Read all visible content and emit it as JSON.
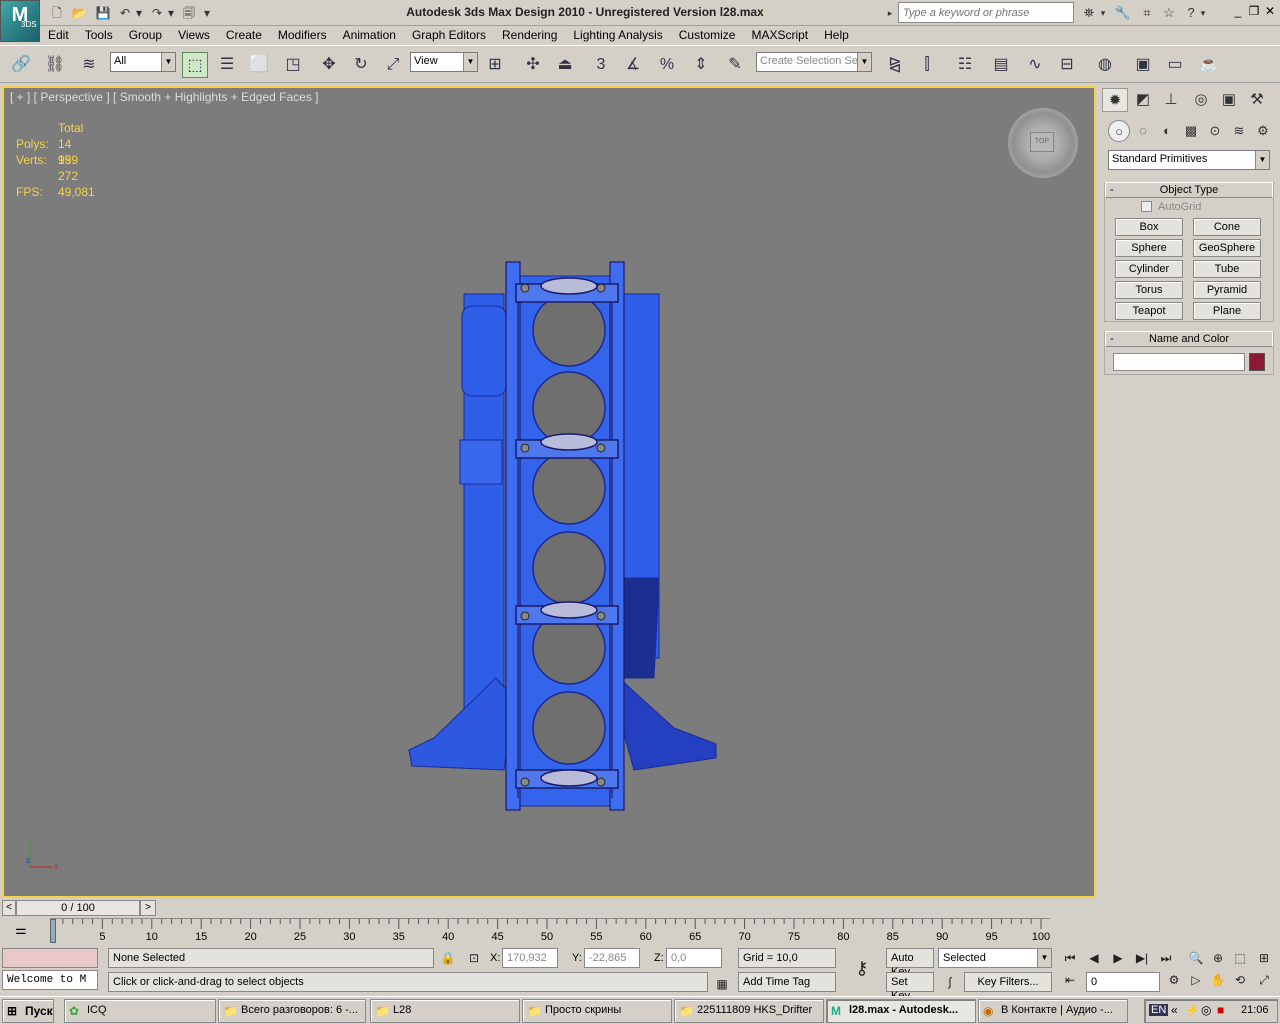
{
  "app": {
    "logo_text": "M",
    "logo_sub": "3DS",
    "title": "Autodesk 3ds Max Design 2010    - Unregistered Version    l28.max"
  },
  "search": {
    "placeholder": "Type a keyword or phrase"
  },
  "menu": [
    "Edit",
    "Tools",
    "Group",
    "Views",
    "Create",
    "Modifiers",
    "Animation",
    "Graph Editors",
    "Rendering",
    "Lighting Analysis",
    "Customize",
    "MAXScript",
    "Help"
  ],
  "toolbar": {
    "selection_filter": "All",
    "ref_coord": "View",
    "named_selection": "Create Selection Se",
    "snap_label": "3"
  },
  "viewport": {
    "label": "[ + ] [ Perspective ] [ Smooth + Highlights + Edged Faces ]",
    "stats": {
      "total_label": "Total",
      "polys_label": "Polys:",
      "polys_value": "14 959",
      "verts_label": "Verts:",
      "verts_value": "19 272",
      "fps_label": "FPS:",
      "fps_value": "49,081"
    },
    "viewcube_label": "TOP",
    "axis": {
      "x": "x",
      "y": "y",
      "z": "z"
    }
  },
  "command_panel": {
    "dropdown": "Standard Primitives",
    "object_type": {
      "title": "Object Type",
      "autogrid": "AutoGrid",
      "buttons": [
        "Box",
        "Cone",
        "Sphere",
        "GeoSphere",
        "Cylinder",
        "Tube",
        "Torus",
        "Pyramid",
        "Teapot",
        "Plane"
      ]
    },
    "name_color": {
      "title": "Name and Color",
      "name_value": "",
      "color": "#8b1a3a"
    }
  },
  "timeline": {
    "frame_display": "0 / 100",
    "ticks": [
      "0",
      "5",
      "10",
      "15",
      "20",
      "25",
      "30",
      "35",
      "40",
      "45",
      "50",
      "55",
      "60",
      "65",
      "70",
      "75",
      "80",
      "85",
      "90",
      "95",
      "100"
    ]
  },
  "status": {
    "maxscript_listener": "Welcome to M",
    "selection": "None Selected",
    "prompt": "Click or click-and-drag to select objects",
    "x_label": "X:",
    "x_value": "170,932",
    "y_label": "Y:",
    "y_value": "-22,865",
    "z_label": "Z:",
    "z_value": "0,0",
    "grid": "Grid = 10,0",
    "add_time_tag": "Add Time Tag",
    "auto_key": "Auto Key",
    "set_key": "Set Key",
    "key_mode": "Selected",
    "key_filters": "Key Filters...",
    "current_frame": "0"
  },
  "taskbar": {
    "start": "Пуск",
    "tasks": [
      "ICQ",
      "Всего разговоров: 6 -...",
      "L28",
      "Просто скрины",
      "225111809 HKS_Drifter",
      "l28.max - Autodesk...",
      "В Контакте | Аудио -..."
    ],
    "lang": "EN",
    "clock": "21:06"
  },
  "colors": {
    "viewport_bg": "#7c7c7c",
    "active_border": "#f2d34a",
    "model_blue": "#2f5ee8"
  }
}
